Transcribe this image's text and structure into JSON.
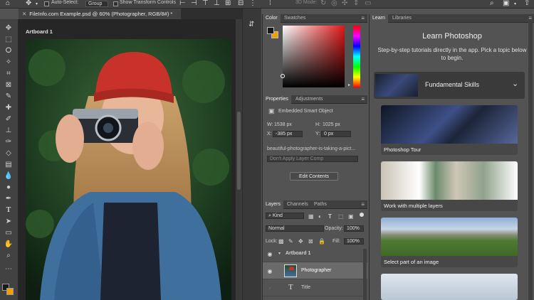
{
  "options_bar": {
    "auto_select_label": "Auto-Select:",
    "auto_select_value": "Group",
    "transform_label": "Show Transform Controls",
    "mode_3d_label": "3D Mode:"
  },
  "document_tab": {
    "title": "FileInfo.com Example.psd @ 60% (Photographer, RGB/8#) *"
  },
  "canvas": {
    "artboard_label": "Artboard 1"
  },
  "color_panel": {
    "tabs": [
      "Color",
      "Swatches"
    ],
    "foreground": "#1a1a1a",
    "background": "#f0a000"
  },
  "properties_panel": {
    "tabs": [
      "Properties",
      "Adjustments"
    ],
    "object_type": "Embedded Smart Object",
    "w_label": "W:",
    "w_value": "1538 px",
    "h_label": "H:",
    "h_value": "1025 px",
    "x_label": "X:",
    "x_value": "-385 px",
    "y_label": "Y:",
    "y_value": "0 px",
    "file_name": "beautiful-photographer-is-taking-a-pict...",
    "layer_comp": "Don't Apply Layer Comp",
    "edit_button": "Edit Contents"
  },
  "layers_panel": {
    "tabs": [
      "Layers",
      "Channels",
      "Paths"
    ],
    "filter_kind": "Kind",
    "blend_mode": "Normal",
    "opacity_label": "Opacity:",
    "opacity_value": "100%",
    "lock_label": "Lock:",
    "fill_label": "Fill:",
    "fill_value": "100%",
    "layers": [
      {
        "name": "Artboard 1"
      },
      {
        "name": "Photographer"
      },
      {
        "name": "Title"
      }
    ]
  },
  "learn_panel": {
    "tabs": [
      "Learn",
      "Libraries"
    ],
    "title": "Learn Photoshop",
    "subtitle": "Step-by-step tutorials directly in the app. Pick a topic below to begin.",
    "section": "Fundamental Skills",
    "cards": [
      {
        "label": "Photoshop Tour"
      },
      {
        "label": "Work with multiple layers"
      },
      {
        "label": "Select part of an image"
      }
    ]
  }
}
